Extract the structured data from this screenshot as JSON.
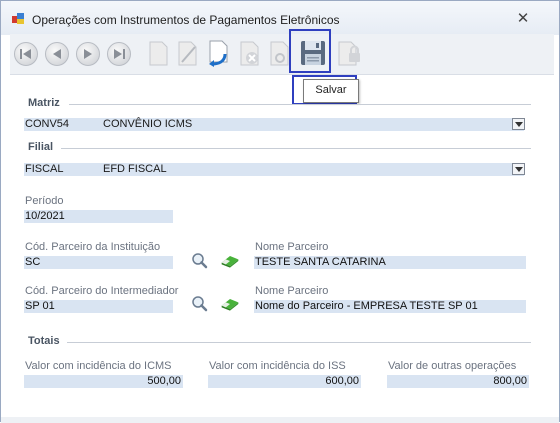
{
  "window": {
    "title": "Operações com Instrumentos de Pagamentos Eletrônicos",
    "close_glyph": "✕"
  },
  "toolbar": {
    "buttons": [
      {
        "name": "first-record",
        "icon": "first-icon",
        "enabled": false
      },
      {
        "name": "previous-record",
        "icon": "previous-icon",
        "enabled": false
      },
      {
        "name": "next-record",
        "icon": "next-icon",
        "enabled": false
      },
      {
        "name": "last-record",
        "icon": "last-icon",
        "enabled": false
      },
      {
        "name": "new",
        "icon": "new-document-icon",
        "enabled": false
      },
      {
        "name": "edit",
        "icon": "edit-pencil-icon",
        "enabled": false
      },
      {
        "name": "undo",
        "icon": "undo-document-icon",
        "enabled": true
      },
      {
        "name": "delete",
        "icon": "delete-icon",
        "enabled": false
      },
      {
        "name": "find",
        "icon": "search-icon",
        "enabled": false
      },
      {
        "name": "save",
        "icon": "floppy-disk-icon",
        "enabled": true
      },
      {
        "name": "lock",
        "icon": "lock-icon",
        "enabled": false
      }
    ],
    "tooltip": "Salvar"
  },
  "matriz": {
    "label": "Matriz",
    "code": "CONV54",
    "description": "CONVÊNIO ICMS"
  },
  "filial": {
    "label": "Filial",
    "code": "FISCAL",
    "description": "EFD FISCAL"
  },
  "periodo": {
    "label": "Período",
    "value": "10/2021"
  },
  "parceiro_instituicao": {
    "code_label": "Cód. Parceiro da Instituição",
    "code": "SC",
    "name_label": "Nome Parceiro",
    "name": "TESTE SANTA CATARINA"
  },
  "parceiro_intermediador": {
    "code_label": "Cód. Parceiro do Intermediador",
    "code": "SP 01",
    "name_label": "Nome Parceiro",
    "name": "Nome do Parceiro - EMPRESA TESTE SP 01"
  },
  "totais": {
    "label": "Totais",
    "icms_label": "Valor com incidência do ICMS",
    "icms": "500,00",
    "iss_label": "Valor com incidência do ISS",
    "iss": "600,00",
    "outras_label": "Valor de outras operações",
    "outras": "800,00"
  },
  "colors": {
    "field_bg": "#d9e4f2",
    "highlight": "#2f3fbf"
  }
}
